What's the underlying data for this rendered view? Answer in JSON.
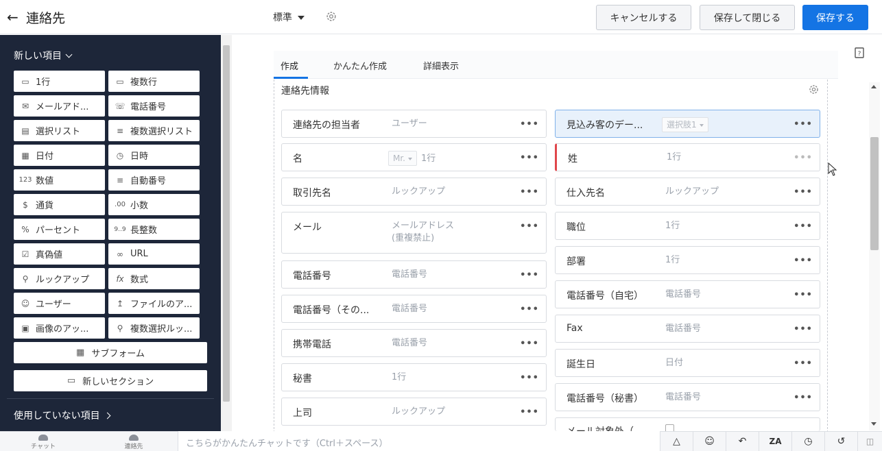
{
  "header": {
    "back_icon": "arrow-left-icon",
    "title": "連絡先",
    "layout_select": "標準",
    "cancel": "キャンセルする",
    "save_close": "保存して閉じる",
    "save": "保存する"
  },
  "sidebar": {
    "new_items": "新しい項目",
    "fields": [
      {
        "label": "1行",
        "icon": "single-line-icon"
      },
      {
        "label": "複数行",
        "icon": "multi-line-icon"
      },
      {
        "label": "メールアド...",
        "icon": "mail-icon"
      },
      {
        "label": "電話番号",
        "icon": "phone-icon"
      },
      {
        "label": "選択リスト",
        "icon": "picklist-icon"
      },
      {
        "label": "複数選択リスト",
        "icon": "multiselect-icon"
      },
      {
        "label": "日付",
        "icon": "calendar-icon"
      },
      {
        "label": "日時",
        "icon": "datetime-icon"
      },
      {
        "label": "数値",
        "icon": "number-icon"
      },
      {
        "label": "自動番号",
        "icon": "autonumber-icon"
      },
      {
        "label": "通貨",
        "icon": "currency-icon"
      },
      {
        "label": "小数",
        "icon": "decimal-icon"
      },
      {
        "label": "パーセント",
        "icon": "percent-icon"
      },
      {
        "label": "長整数",
        "icon": "long-integer-icon"
      },
      {
        "label": "真偽値",
        "icon": "checkbox-icon"
      },
      {
        "label": "URL",
        "icon": "link-icon"
      },
      {
        "label": "ルックアップ",
        "icon": "lookup-icon"
      },
      {
        "label": "数式",
        "icon": "formula-icon"
      },
      {
        "label": "ユーザー",
        "icon": "user-icon"
      },
      {
        "label": "ファイルのア...",
        "icon": "upload-icon"
      },
      {
        "label": "画像のアッ...",
        "icon": "image-icon"
      },
      {
        "label": "複数選択ルッ...",
        "icon": "multi-lookup-icon"
      }
    ],
    "subform": "サブフォーム",
    "new_section": "新しいセクション",
    "unused_items": "使用していない項目"
  },
  "tabs": [
    "作成",
    "かんたん作成",
    "詳細表示"
  ],
  "section_title": "連絡先情報",
  "left_fields": [
    {
      "label": "連絡先の担当者",
      "value": "ユーザー"
    },
    {
      "label": "名",
      "prefix": "Mr.",
      "value": "1行"
    },
    {
      "label": "取引先名",
      "value": "ルックアップ"
    },
    {
      "label": "メール",
      "value": "メールアドレス",
      "value2": "(重複禁止)"
    },
    {
      "label": "電話番号",
      "value": "電話番号"
    },
    {
      "label": "電話番号（その...",
      "value": "電話番号"
    },
    {
      "label": "携帯電話",
      "value": "電話番号"
    },
    {
      "label": "秘書",
      "value": "1行"
    },
    {
      "label": "上司",
      "value": "ルックアップ"
    }
  ],
  "right_fields": [
    {
      "label": "見込み客のデー...",
      "value": "選択肢1"
    },
    {
      "label": "姓",
      "value": "1行"
    },
    {
      "label": "仕入先名",
      "value": "ルックアップ"
    },
    {
      "label": "職位",
      "value": "1行"
    },
    {
      "label": "部署",
      "value": "1行"
    },
    {
      "label": "電話番号（自宅）",
      "value": "電話番号"
    },
    {
      "label": "Fax",
      "value": "電話番号"
    },
    {
      "label": "誕生日",
      "value": "日付"
    },
    {
      "label": "電話番号（秘書）",
      "value": "電話番号"
    },
    {
      "label": "メール対象外（"
    }
  ],
  "bottom": {
    "chat": "チャット",
    "contacts": "連絡先",
    "chat_placeholder": "こちらがかんたんチャットです（Ctrl＋スペース）"
  }
}
